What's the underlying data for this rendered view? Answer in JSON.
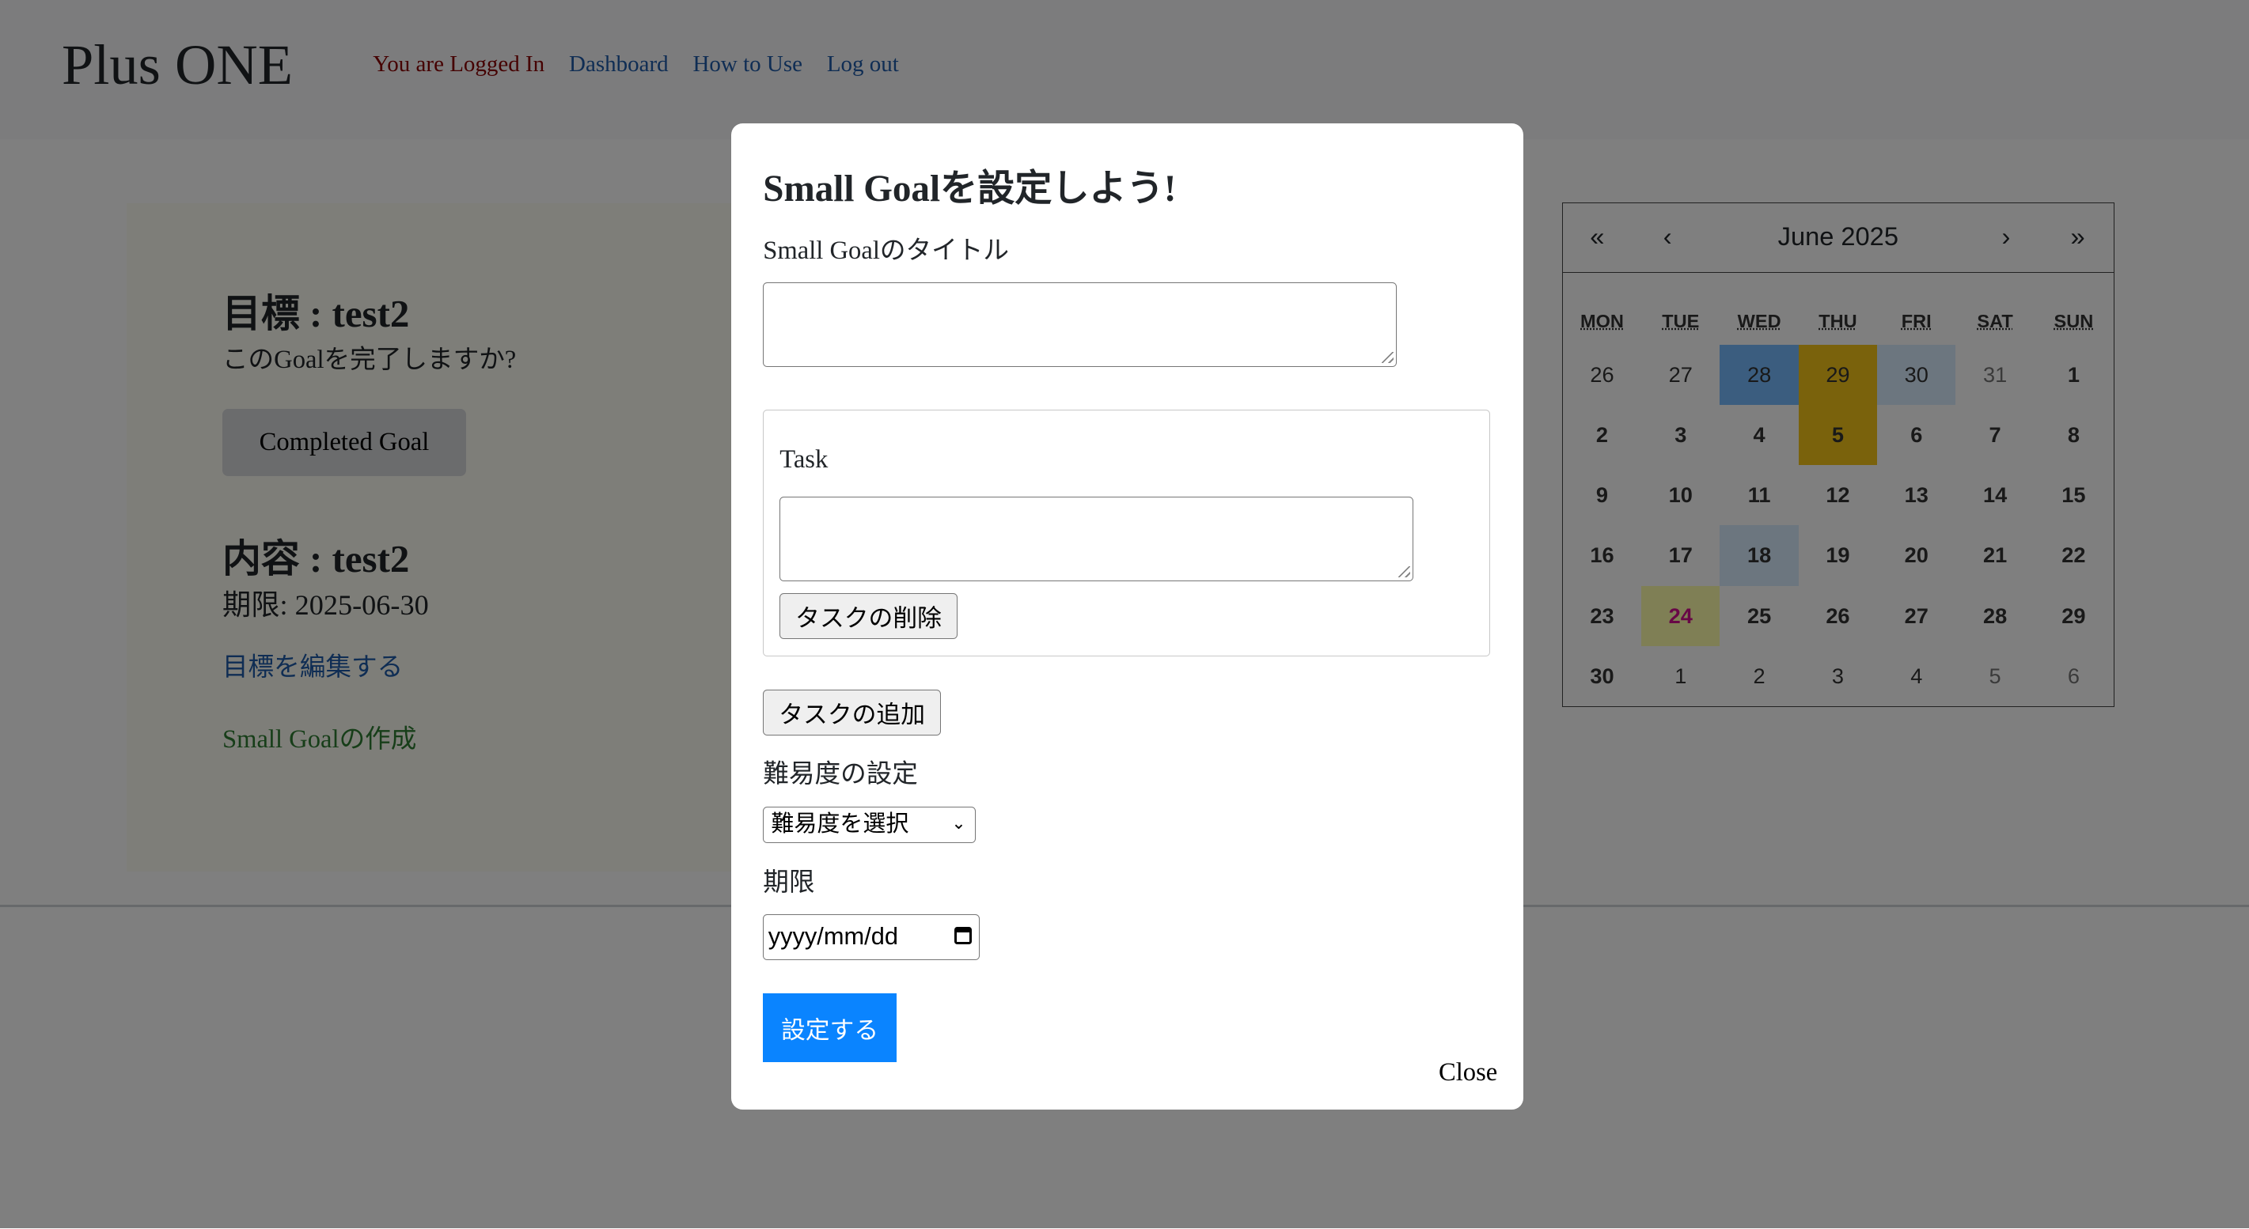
{
  "header": {
    "brand": "Plus ONE",
    "nav": {
      "logged_in": "You are Logged In",
      "dashboard": "Dashboard",
      "how_to_use": "How to Use",
      "logout": "Log out"
    }
  },
  "goal": {
    "title": "目標 : test2",
    "question": "このGoalを完了しますか?",
    "completed_button": "Completed Goal",
    "content_title": "内容 : test2",
    "deadline": "期限: 2025-06-30",
    "edit_link": "目標を編集する",
    "create_small_goal_link": "Small Goalの作成"
  },
  "calendar": {
    "prev_year": "«",
    "prev_month": "‹",
    "month_label": "June 2025",
    "next_month": "›",
    "next_year": "»",
    "weekdays": [
      "MON",
      "TUE",
      "WED",
      "THU",
      "FRI",
      "SAT",
      "SUN"
    ],
    "days": [
      {
        "label": "26",
        "bold": false,
        "muted": false,
        "hl": ""
      },
      {
        "label": "27",
        "bold": false,
        "muted": false,
        "hl": ""
      },
      {
        "label": "28",
        "bold": false,
        "muted": false,
        "hl": "range"
      },
      {
        "label": "29",
        "bold": false,
        "muted": false,
        "hl": "selected"
      },
      {
        "label": "30",
        "bold": false,
        "muted": false,
        "hl": "light"
      },
      {
        "label": "31",
        "bold": false,
        "muted": true,
        "hl": ""
      },
      {
        "label": "1",
        "bold": true,
        "muted": false,
        "hl": ""
      },
      {
        "label": "2",
        "bold": true,
        "muted": false,
        "hl": ""
      },
      {
        "label": "3",
        "bold": true,
        "muted": false,
        "hl": ""
      },
      {
        "label": "4",
        "bold": true,
        "muted": false,
        "hl": ""
      },
      {
        "label": "5",
        "bold": true,
        "muted": false,
        "hl": "selected"
      },
      {
        "label": "6",
        "bold": true,
        "muted": false,
        "hl": ""
      },
      {
        "label": "7",
        "bold": true,
        "muted": false,
        "hl": ""
      },
      {
        "label": "8",
        "bold": true,
        "muted": false,
        "hl": ""
      },
      {
        "label": "9",
        "bold": true,
        "muted": false,
        "hl": ""
      },
      {
        "label": "10",
        "bold": true,
        "muted": false,
        "hl": ""
      },
      {
        "label": "11",
        "bold": true,
        "muted": false,
        "hl": ""
      },
      {
        "label": "12",
        "bold": true,
        "muted": false,
        "hl": ""
      },
      {
        "label": "13",
        "bold": true,
        "muted": false,
        "hl": ""
      },
      {
        "label": "14",
        "bold": true,
        "muted": false,
        "hl": ""
      },
      {
        "label": "15",
        "bold": true,
        "muted": false,
        "hl": ""
      },
      {
        "label": "16",
        "bold": true,
        "muted": false,
        "hl": ""
      },
      {
        "label": "17",
        "bold": true,
        "muted": false,
        "hl": ""
      },
      {
        "label": "18",
        "bold": true,
        "muted": false,
        "hl": "light"
      },
      {
        "label": "19",
        "bold": true,
        "muted": false,
        "hl": ""
      },
      {
        "label": "20",
        "bold": true,
        "muted": false,
        "hl": ""
      },
      {
        "label": "21",
        "bold": true,
        "muted": false,
        "hl": ""
      },
      {
        "label": "22",
        "bold": true,
        "muted": false,
        "hl": ""
      },
      {
        "label": "23",
        "bold": true,
        "muted": false,
        "hl": ""
      },
      {
        "label": "24",
        "bold": true,
        "muted": false,
        "hl": "today"
      },
      {
        "label": "25",
        "bold": true,
        "muted": false,
        "hl": ""
      },
      {
        "label": "26",
        "bold": true,
        "muted": false,
        "hl": ""
      },
      {
        "label": "27",
        "bold": true,
        "muted": false,
        "hl": ""
      },
      {
        "label": "28",
        "bold": true,
        "muted": false,
        "hl": ""
      },
      {
        "label": "29",
        "bold": true,
        "muted": false,
        "hl": ""
      },
      {
        "label": "30",
        "bold": true,
        "muted": false,
        "hl": ""
      },
      {
        "label": "1",
        "bold": false,
        "muted": false,
        "hl": ""
      },
      {
        "label": "2",
        "bold": false,
        "muted": false,
        "hl": ""
      },
      {
        "label": "3",
        "bold": false,
        "muted": false,
        "hl": ""
      },
      {
        "label": "4",
        "bold": false,
        "muted": false,
        "hl": ""
      },
      {
        "label": "5",
        "bold": false,
        "muted": true,
        "hl": ""
      },
      {
        "label": "6",
        "bold": false,
        "muted": true,
        "hl": ""
      }
    ],
    "today_text_color": "#d10f8c"
  },
  "modal": {
    "title": "Small Goalを設定しよう!",
    "title_label": "Small Goalのタイトル",
    "title_value": "",
    "task_label": "Task",
    "task_value": "",
    "delete_task_button": "タスクの削除",
    "add_task_button": "タスクの追加",
    "difficulty_label": "難易度の設定",
    "difficulty_selected": "難易度を選択",
    "deadline_label": "期限",
    "deadline_placeholder": "yyyy/mm/dd",
    "submit_button": "設定する",
    "close_button": "Close"
  },
  "colors": {
    "overlay": "rgba(0,0,0,0.5)",
    "primary_button": "#0a84ff",
    "logged_in_text": "#8b0000",
    "link": "#1f5aa8",
    "create_link": "#2e7d32",
    "calendar_range": "#76baff",
    "calendar_selected": "#f5c518"
  }
}
